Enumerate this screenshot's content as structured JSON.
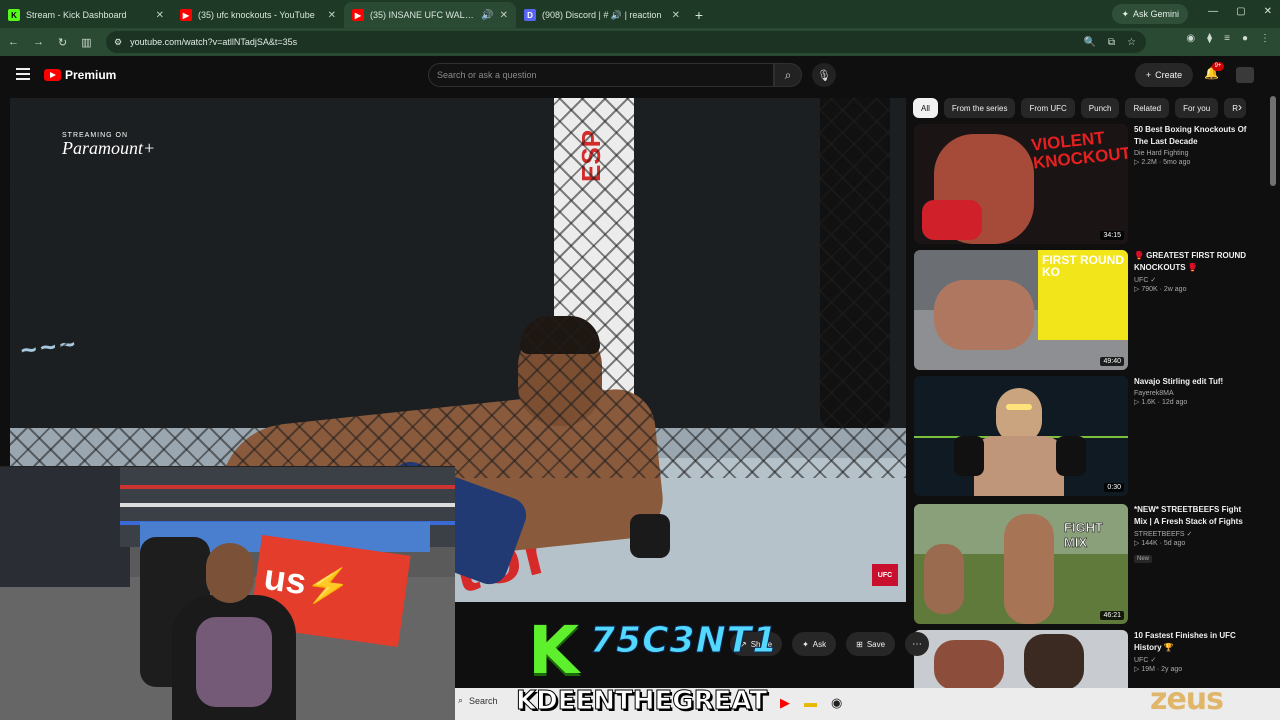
{
  "browser": {
    "tabs": [
      {
        "label": "Stream - Kick Dashboard",
        "icon": "kick-icon",
        "color": "#53fc18"
      },
      {
        "label": "(35) ufc knockouts - YouTube",
        "icon": "youtube-icon",
        "color": "#ff0000"
      },
      {
        "label": "(35) INSANE UFC WALK OF",
        "icon": "youtube-icon",
        "color": "#ff0000"
      },
      {
        "label": "(908) Discord | # 🔊 | reaction",
        "icon": "discord-icon",
        "color": "#5865f2"
      }
    ],
    "new_tab": "+",
    "gemini": "Ask Gemini",
    "url": "youtube.com/watch?v=atllNTadjSA&t=35s"
  },
  "youtube": {
    "logo_text": "Premium",
    "search_placeholder": "Search or ask a question",
    "create_label": "Create",
    "notification_count": "9+"
  },
  "video": {
    "watermark_small": "STREAMING ON",
    "watermark_brand": "Paramount+",
    "sponsor_red": "tor",
    "corner_badge": "UFC"
  },
  "chips": [
    "All",
    "From the series",
    "From UFC",
    "Punch",
    "Related",
    "For you",
    "R"
  ],
  "recommendations": [
    {
      "title": "50 Best Boxing Knockouts Of The Last Decade",
      "channel": "Die Hard Fighting",
      "meta": "▷ 2.2M · 5mo ago",
      "duration": "34:15",
      "thumb_text": "VIOLENT KNOCKOUTS",
      "new": ""
    },
    {
      "title": "🥊 GREATEST FIRST ROUND KNOCKOUTS 🥊",
      "channel": "UFC ✓",
      "meta": "▷ 790K · 2w ago",
      "duration": "49:40",
      "thumb_text": "FIRST ROUND KO",
      "new": ""
    },
    {
      "title": "Navajo Stirling edit Tuf!",
      "channel": "Fayerek8MA",
      "meta": "▷ 1.6K · 12d ago",
      "duration": "0:30",
      "thumb_text": "",
      "new": ""
    },
    {
      "title": "*NEW* STREETBEEFS Fight Mix | A Fresh Stack of Fights",
      "channel": "STREETBEEFS ✓",
      "meta": "▷ 144K · 5d ago",
      "duration": "46:21",
      "thumb_text": "FIGHT MIX",
      "new": "New"
    },
    {
      "title": "10 Fastest Finishes in UFC History 🏆",
      "channel": "UFC ✓",
      "meta": "▷ 19M · 2y ago",
      "duration": "",
      "thumb_text": "",
      "new": ""
    }
  ],
  "actions": {
    "share": "Share",
    "ask": "Ask",
    "save": "Save"
  },
  "overlays": {
    "kick_letter": "K",
    "handle": "75C3NT1",
    "streamer_name": "KDEENTHEGREAT",
    "sponsor": "zeus"
  },
  "taskbar": {
    "search": "Search"
  }
}
